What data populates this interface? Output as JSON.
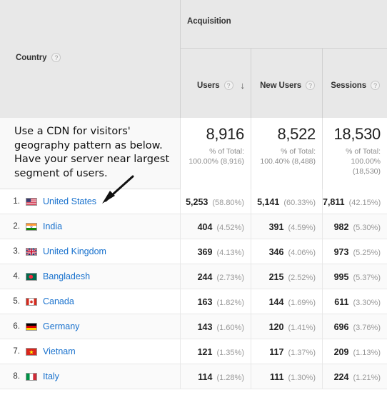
{
  "header": {
    "dimension_label": "Country",
    "dimension_help": "?",
    "group_label": "Acquisition",
    "metrics": [
      {
        "label": "Users",
        "help": "?",
        "sorted": true,
        "sort_arrow": "↓"
      },
      {
        "label": "New Users",
        "help": "?",
        "sorted": false,
        "sort_arrow": ""
      },
      {
        "label": "Sessions",
        "help": "?",
        "sorted": false,
        "sort_arrow": ""
      }
    ]
  },
  "annotation": {
    "note": "Use a CDN for visitors' geography pattern as below. Have your server near largest segment of users.",
    "arrow_name": "arrow-pointing-to-united-states"
  },
  "summary": {
    "metrics": [
      {
        "value": "8,916",
        "label": "% of Total:",
        "detail": "100.00% (8,916)"
      },
      {
        "value": "8,522",
        "label": "% of Total:",
        "detail": "100.40% (8,488)"
      },
      {
        "value": "18,530",
        "label": "% of Total:",
        "detail": "100.00% (18,530)"
      }
    ]
  },
  "rows": [
    {
      "rank": "1.",
      "country": "United States",
      "flag": "us",
      "users": "5,253",
      "users_pct": "(58.80%)",
      "new_users": "5,141",
      "new_users_pct": "(60.33%)",
      "sessions": "7,811",
      "sessions_pct": "(42.15%)"
    },
    {
      "rank": "2.",
      "country": "India",
      "flag": "in",
      "users": "404",
      "users_pct": "(4.52%)",
      "new_users": "391",
      "new_users_pct": "(4.59%)",
      "sessions": "982",
      "sessions_pct": "(5.30%)"
    },
    {
      "rank": "3.",
      "country": "United Kingdom",
      "flag": "gb",
      "users": "369",
      "users_pct": "(4.13%)",
      "new_users": "346",
      "new_users_pct": "(4.06%)",
      "sessions": "973",
      "sessions_pct": "(5.25%)"
    },
    {
      "rank": "4.",
      "country": "Bangladesh",
      "flag": "bd",
      "users": "244",
      "users_pct": "(2.73%)",
      "new_users": "215",
      "new_users_pct": "(2.52%)",
      "sessions": "995",
      "sessions_pct": "(5.37%)"
    },
    {
      "rank": "5.",
      "country": "Canada",
      "flag": "ca",
      "users": "163",
      "users_pct": "(1.82%)",
      "new_users": "144",
      "new_users_pct": "(1.69%)",
      "sessions": "611",
      "sessions_pct": "(3.30%)"
    },
    {
      "rank": "6.",
      "country": "Germany",
      "flag": "de",
      "users": "143",
      "users_pct": "(1.60%)",
      "new_users": "120",
      "new_users_pct": "(1.41%)",
      "sessions": "696",
      "sessions_pct": "(3.76%)"
    },
    {
      "rank": "7.",
      "country": "Vietnam",
      "flag": "vn",
      "users": "121",
      "users_pct": "(1.35%)",
      "new_users": "117",
      "new_users_pct": "(1.37%)",
      "sessions": "209",
      "sessions_pct": "(1.13%)"
    },
    {
      "rank": "8.",
      "country": "Italy",
      "flag": "it",
      "users": "114",
      "users_pct": "(1.28%)",
      "new_users": "111",
      "new_users_pct": "(1.30%)",
      "sessions": "224",
      "sessions_pct": "(1.21%)"
    }
  ],
  "colors": {
    "link": "#1871cd",
    "header_bg": "#e8e8e8",
    "summary_bg": "#f9f9f9",
    "muted_text": "#999999"
  }
}
